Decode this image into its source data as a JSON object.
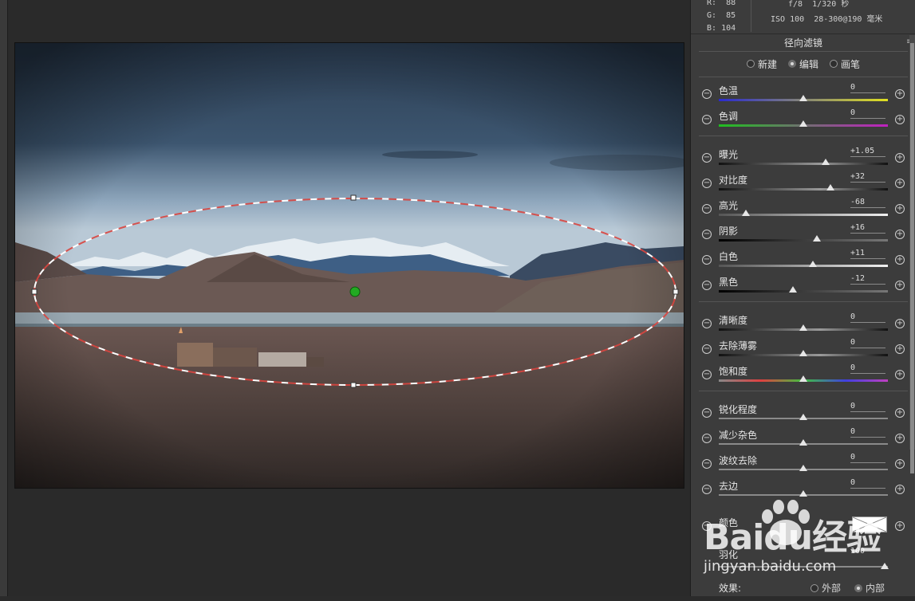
{
  "info": {
    "r_label": "R:",
    "r_value": "88",
    "g_label": "G:",
    "g_value": "85",
    "b_label": "B:",
    "b_value": "104",
    "aperture": "f/8",
    "shutter": "1/320 秒",
    "iso": "ISO 100",
    "lens": "28-300@190 毫米"
  },
  "panel": {
    "title": "径向滤镜",
    "modes": [
      "新建",
      "编辑",
      "画笔"
    ],
    "selected_mode": "编辑"
  },
  "sliders": [
    {
      "label": "色温",
      "value": "0",
      "pos": 0.5,
      "track": "temp"
    },
    {
      "label": "色调",
      "value": "0",
      "pos": 0.5,
      "track": "tint"
    },
    {
      "label": "曝光",
      "value": "+1.05",
      "pos": 0.63,
      "track": "gray"
    },
    {
      "label": "对比度",
      "value": "+32",
      "pos": 0.66,
      "track": "gray"
    },
    {
      "label": "高光",
      "value": "-68",
      "pos": 0.16,
      "track": "light"
    },
    {
      "label": "阴影",
      "value": "+16",
      "pos": 0.58,
      "track": "dark"
    },
    {
      "label": "白色",
      "value": "+11",
      "pos": 0.555,
      "track": "light"
    },
    {
      "label": "黑色",
      "value": "-12",
      "pos": 0.44,
      "track": "dark"
    },
    {
      "label": "清晰度",
      "value": "0",
      "pos": 0.5,
      "track": "gray"
    },
    {
      "label": "去除薄雾",
      "value": "0",
      "pos": 0.5,
      "track": "gray"
    },
    {
      "label": "饱和度",
      "value": "0",
      "pos": 0.5,
      "track": "sat"
    },
    {
      "label": "锐化程度",
      "value": "0",
      "pos": 0.5,
      "track": "plain"
    },
    {
      "label": "减少杂色",
      "value": "0",
      "pos": 0.5,
      "track": "plain"
    },
    {
      "label": "波纹去除",
      "value": "0",
      "pos": 0.5,
      "track": "plain"
    },
    {
      "label": "去边",
      "value": "0",
      "pos": 0.5,
      "track": "plain"
    }
  ],
  "color_row": {
    "label": "颜色"
  },
  "feather": {
    "label": "羽化",
    "value": "100",
    "pos": 1.0
  },
  "effect": {
    "label": "效果:",
    "options": [
      "外部",
      "内部"
    ]
  },
  "watermark": {
    "brand": "Baidu经验",
    "url": "jingyan.baidu.com"
  },
  "colors": {
    "accent_pin": "#22aa22",
    "ellipse_red": "#d9453f"
  }
}
